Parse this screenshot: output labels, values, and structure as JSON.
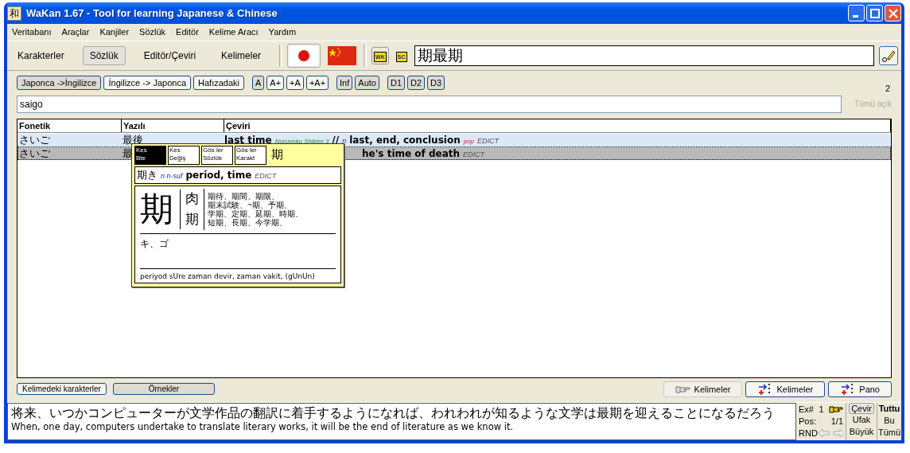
{
  "window": {
    "title": "WaKan 1.67 - Tool for learning Japanese & Chinese",
    "app_icon": "和"
  },
  "menu": [
    "Veritabanı",
    "Araçlar",
    "Kanjiler",
    "Sözlük",
    "Editör",
    "Kelime Aracı",
    "Yardım"
  ],
  "modes": [
    {
      "label": "Karakterler",
      "selected": false
    },
    {
      "label": "Sözlük",
      "selected": true
    },
    {
      "label": "Editör/Çeviri",
      "selected": false
    },
    {
      "label": "Kelimeler",
      "selected": false
    }
  ],
  "languages": [
    {
      "kind": "japan",
      "selected": true
    },
    {
      "kind": "china",
      "selected": false
    }
  ],
  "dict_icons": [
    "WK",
    "SC"
  ],
  "clipboard": {
    "value": "期最期"
  },
  "direction_buttons": [
    {
      "label": "Japonca ->İngilizce",
      "selected": true
    },
    {
      "label": "İngilizce -> Japonca",
      "selected": false
    },
    {
      "label": "Hafızadaki",
      "selected": false
    }
  ],
  "search_buttons": [
    {
      "label": "A",
      "selected": true
    },
    {
      "label": "A+",
      "selected": false
    },
    {
      "label": "+A",
      "selected": false
    },
    {
      "label": "+A+",
      "selected": false
    }
  ],
  "mode_buttons": [
    {
      "label": "Inf",
      "selected": true
    },
    {
      "label": "Auto",
      "selected": true
    }
  ],
  "dict_buttons": [
    {
      "label": "D1",
      "selected": true
    },
    {
      "label": "D2",
      "selected": true
    },
    {
      "label": "D3",
      "selected": true
    }
  ],
  "result_count": "2",
  "search": {
    "value": "saigo"
  },
  "expand_all": {
    "label": "Tümü açık",
    "disabled": true
  },
  "table": {
    "columns": [
      "Fonetik",
      "Yazılı",
      "Çeviri"
    ],
    "rows": [
      {
        "phonetic": "さいご",
        "written": "最後",
        "selected": false,
        "translation": [
          {
            "kind": "main",
            "text": "last time"
          },
          {
            "kind": "note",
            "text": "Noruyoku Shiken 3"
          },
          {
            "kind": "main",
            "text": "//"
          },
          {
            "kind": "pos",
            "text": "n"
          },
          {
            "kind": "main",
            "text": "last, end, conclusion"
          },
          {
            "kind": "pop",
            "text": "pop"
          },
          {
            "kind": "source",
            "text": "EDICT"
          }
        ]
      },
      {
        "phonetic": "さいご",
        "written": "最",
        "selected": true,
        "translation": [
          {
            "kind": "main",
            "text": "he's time of death"
          },
          {
            "kind": "source",
            "text": "EDICT"
          }
        ]
      }
    ]
  },
  "popup": {
    "buttons": [
      {
        "lines": [
          "Kes",
          "Bte"
        ],
        "selected": true
      },
      {
        "lines": [
          "Kes",
          "Değiş"
        ],
        "selected": false
      },
      {
        "lines": [
          "Gös ler",
          "Sözlük"
        ],
        "selected": false
      },
      {
        "lines": [
          "Gös ler",
          "Karakt"
        ],
        "selected": false
      }
    ],
    "char": "期",
    "entry": [
      {
        "kind": "word",
        "text": "期き"
      },
      {
        "kind": "pos",
        "text": "n n-suf"
      },
      {
        "kind": "main",
        "text": "period, time"
      },
      {
        "kind": "source",
        "text": "EDICT"
      }
    ],
    "kanji": "期",
    "radicals": [
      "肉",
      "期"
    ],
    "compounds": [
      "期待、期間、期限、",
      "期末試験、~期、予期、",
      "学期、定期、延期、時期、",
      "短期、長期、今学期、"
    ],
    "readings": "キ、ゴ",
    "meaning": "periyod sUre zaman devir, zaman vakit, (gUnUn)"
  },
  "bottom_tabs": [
    {
      "label": "Kelimedeki karakterler",
      "selected": false
    },
    {
      "label": "Örnekler",
      "selected": true
    }
  ],
  "word_buttons": [
    {
      "kind": "hand",
      "label": "Kelimeler",
      "disabled": true
    },
    {
      "kind": "add",
      "label": "Kelimeler",
      "disabled": false
    },
    {
      "kind": "add",
      "label": "Pano",
      "disabled": false
    }
  ],
  "example": {
    "japanese": "将来、いつかコンピューターが文学作品の翻訳に着手するようになれば、われわれが知るような文学は最期を迎えることになるだろう",
    "english": "When, one day, computers undertake to translate literary works, it will be the end of literature as we know it.",
    "ex_label": "Ex#",
    "ex_number": "1",
    "pos_label": "Pos:",
    "pos_value": "1/1",
    "random": "RND",
    "translate": "Çevir",
    "small": "Ufak",
    "big": "Büyük",
    "keep": "Tuttu",
    "this": "Bu",
    "all": "Tümü"
  }
}
